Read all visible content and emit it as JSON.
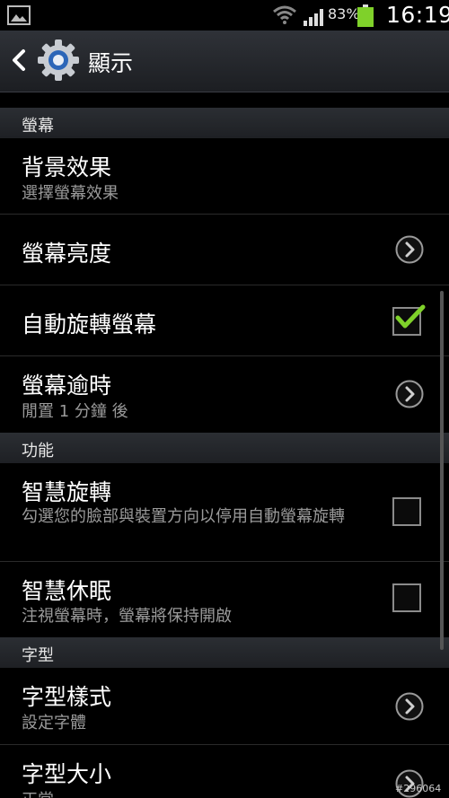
{
  "status": {
    "battery_pct": "83%",
    "time": "16:19"
  },
  "actionbar": {
    "title": "顯示"
  },
  "sections": [
    {
      "header": "螢幕"
    },
    {
      "header": "功能"
    },
    {
      "header": "字型"
    }
  ],
  "items": [
    {
      "title": "背景效果",
      "subtitle": "選擇螢幕效果"
    },
    {
      "title": "螢幕亮度"
    },
    {
      "title": "自動旋轉螢幕",
      "checked": true
    },
    {
      "title": "螢幕逾時",
      "subtitle": "閒置 1 分鐘 後"
    },
    {
      "title": "智慧旋轉",
      "subtitle": "勾選您的臉部與裝置方向以停用自動螢幕旋轉",
      "checked": false
    },
    {
      "title": "智慧休眠",
      "subtitle": "注視螢幕時，螢幕將保持開啟",
      "checked": false
    },
    {
      "title": "字型樣式",
      "subtitle": "設定字體"
    },
    {
      "title": "字型大小",
      "subtitle": "正常"
    }
  ],
  "watermark": "#296064",
  "colors": {
    "check": "#7fd12a",
    "battery": "#7fd12a"
  }
}
